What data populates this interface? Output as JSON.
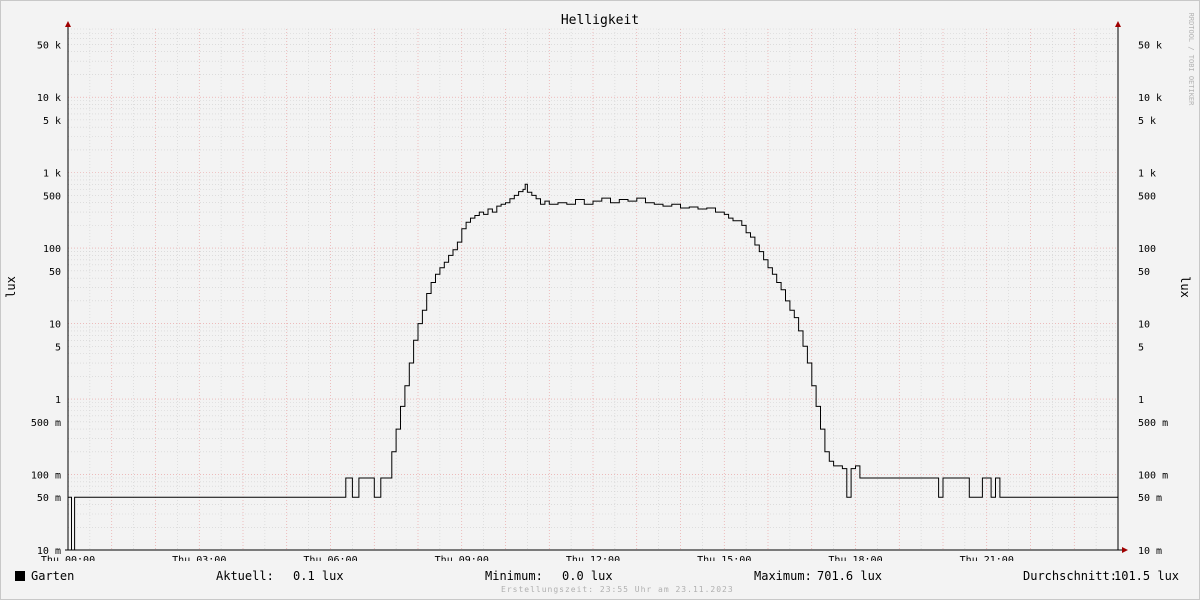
{
  "chart_data": {
    "type": "line",
    "title": "Helligkeit",
    "ylabel": "lux",
    "yscale": "log",
    "ylim": [
      0.01,
      80000
    ],
    "xlim": [
      0,
      24
    ],
    "grid": true,
    "legend": "bottom-left",
    "colors": {
      "line": "#000000",
      "minor_grid": "#d0d0d0",
      "major_grid": "#e89a9a",
      "axis_arrow": "#a00000"
    },
    "y_ticks": [
      {
        "value": 50000,
        "label": "50 k"
      },
      {
        "value": 10000,
        "label": "10 k"
      },
      {
        "value": 5000,
        "label": "5 k"
      },
      {
        "value": 1000,
        "label": "1 k"
      },
      {
        "value": 500,
        "label": "500"
      },
      {
        "value": 100,
        "label": "100"
      },
      {
        "value": 50,
        "label": "50"
      },
      {
        "value": 10,
        "label": "10"
      },
      {
        "value": 5,
        "label": "5"
      },
      {
        "value": 1,
        "label": "1"
      },
      {
        "value": 0.5,
        "label": "500 m"
      },
      {
        "value": 0.1,
        "label": "100 m"
      },
      {
        "value": 0.05,
        "label": "50 m"
      },
      {
        "value": 0.01,
        "label": "10 m"
      }
    ],
    "x_ticks": [
      {
        "value": 0,
        "label": "Thu 00:00"
      },
      {
        "value": 3,
        "label": "Thu 03:00"
      },
      {
        "value": 6,
        "label": "Thu 06:00"
      },
      {
        "value": 9,
        "label": "Thu 09:00"
      },
      {
        "value": 12,
        "label": "Thu 12:00"
      },
      {
        "value": 15,
        "label": "Thu 15:00"
      },
      {
        "value": 18,
        "label": "Thu 18:00"
      },
      {
        "value": 21,
        "label": "Thu 21:00"
      }
    ],
    "series": [
      {
        "name": "Garten",
        "color": "#000000",
        "points": [
          [
            0,
            0.05
          ],
          [
            0.05,
            0.05
          ],
          [
            0.08,
            0.01
          ],
          [
            0.12,
            0.01
          ],
          [
            0.15,
            0.05
          ],
          [
            6.3,
            0.05
          ],
          [
            6.35,
            0.09
          ],
          [
            6.45,
            0.09
          ],
          [
            6.5,
            0.05
          ],
          [
            6.6,
            0.05
          ],
          [
            6.65,
            0.09
          ],
          [
            6.95,
            0.09
          ],
          [
            7.0,
            0.05
          ],
          [
            7.1,
            0.05
          ],
          [
            7.15,
            0.09
          ],
          [
            7.3,
            0.09
          ],
          [
            7.4,
            0.2
          ],
          [
            7.5,
            0.4
          ],
          [
            7.6,
            0.8
          ],
          [
            7.7,
            1.5
          ],
          [
            7.8,
            3
          ],
          [
            7.9,
            6
          ],
          [
            8.0,
            10
          ],
          [
            8.1,
            15
          ],
          [
            8.2,
            25
          ],
          [
            8.3,
            35
          ],
          [
            8.4,
            45
          ],
          [
            8.5,
            55
          ],
          [
            8.6,
            65
          ],
          [
            8.7,
            80
          ],
          [
            8.8,
            95
          ],
          [
            8.9,
            120
          ],
          [
            9.0,
            180
          ],
          [
            9.1,
            220
          ],
          [
            9.2,
            250
          ],
          [
            9.3,
            270
          ],
          [
            9.4,
            300
          ],
          [
            9.5,
            280
          ],
          [
            9.6,
            330
          ],
          [
            9.7,
            300
          ],
          [
            9.8,
            360
          ],
          [
            9.9,
            380
          ],
          [
            10.0,
            400
          ],
          [
            10.1,
            450
          ],
          [
            10.2,
            500
          ],
          [
            10.3,
            560
          ],
          [
            10.4,
            600
          ],
          [
            10.45,
            701.6
          ],
          [
            10.5,
            550
          ],
          [
            10.6,
            500
          ],
          [
            10.7,
            450
          ],
          [
            10.8,
            380
          ],
          [
            10.9,
            420
          ],
          [
            11.0,
            380
          ],
          [
            11.2,
            400
          ],
          [
            11.4,
            380
          ],
          [
            11.6,
            440
          ],
          [
            11.8,
            380
          ],
          [
            12.0,
            420
          ],
          [
            12.2,
            460
          ],
          [
            12.4,
            400
          ],
          [
            12.6,
            440
          ],
          [
            12.8,
            420
          ],
          [
            13.0,
            460
          ],
          [
            13.2,
            400
          ],
          [
            13.4,
            380
          ],
          [
            13.6,
            360
          ],
          [
            13.8,
            380
          ],
          [
            14.0,
            340
          ],
          [
            14.2,
            350
          ],
          [
            14.4,
            330
          ],
          [
            14.6,
            340
          ],
          [
            14.8,
            300
          ],
          [
            15.0,
            280
          ],
          [
            15.1,
            250
          ],
          [
            15.2,
            230
          ],
          [
            15.4,
            200
          ],
          [
            15.5,
            160
          ],
          [
            15.6,
            140
          ],
          [
            15.7,
            110
          ],
          [
            15.8,
            90
          ],
          [
            15.9,
            70
          ],
          [
            16.0,
            55
          ],
          [
            16.1,
            45
          ],
          [
            16.2,
            35
          ],
          [
            16.3,
            28
          ],
          [
            16.4,
            20
          ],
          [
            16.5,
            15
          ],
          [
            16.6,
            12
          ],
          [
            16.7,
            8
          ],
          [
            16.8,
            5
          ],
          [
            16.9,
            3
          ],
          [
            17.0,
            1.5
          ],
          [
            17.1,
            0.8
          ],
          [
            17.2,
            0.4
          ],
          [
            17.3,
            0.2
          ],
          [
            17.4,
            0.15
          ],
          [
            17.5,
            0.13
          ],
          [
            17.6,
            0.13
          ],
          [
            17.7,
            0.12
          ],
          [
            17.8,
            0.05
          ],
          [
            17.9,
            0.12
          ],
          [
            18.0,
            0.13
          ],
          [
            18.1,
            0.09
          ],
          [
            19.8,
            0.09
          ],
          [
            19.9,
            0.05
          ],
          [
            20.0,
            0.09
          ],
          [
            20.5,
            0.09
          ],
          [
            20.6,
            0.05
          ],
          [
            20.8,
            0.05
          ],
          [
            20.9,
            0.09
          ],
          [
            21.0,
            0.09
          ],
          [
            21.1,
            0.05
          ],
          [
            21.2,
            0.09
          ],
          [
            21.3,
            0.05
          ],
          [
            24,
            0.05
          ]
        ]
      }
    ]
  },
  "side_label": "RRDTOOL / TOBI OETIKER",
  "legend": {
    "name": "Garten",
    "current_label": "Aktuell:",
    "current_value": "0.1 lux",
    "min_label": "Minimum:",
    "min_value": "0.0 lux",
    "max_label": "Maximum:",
    "max_value": "701.6 lux",
    "avg_label": "Durchschnitt:",
    "avg_value": "101.5 lux"
  },
  "created": "Erstellungszeit: 23:55 Uhr am 23.11.2023"
}
